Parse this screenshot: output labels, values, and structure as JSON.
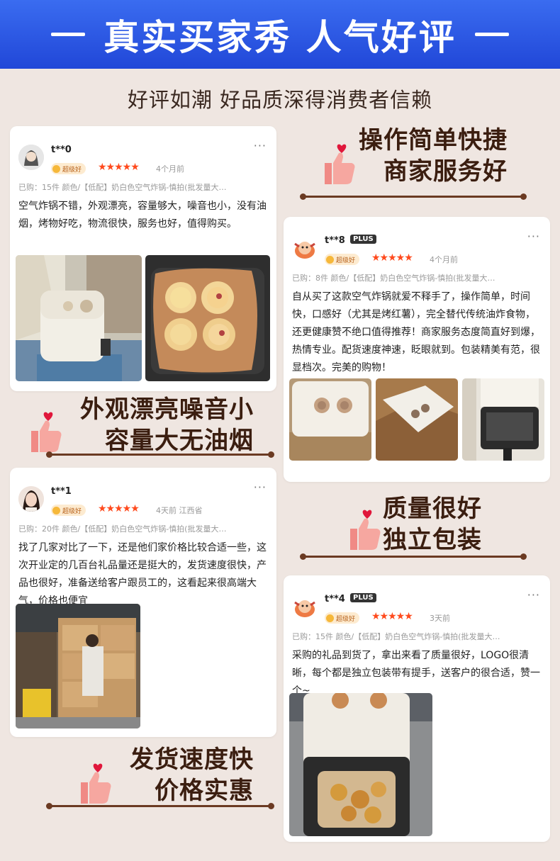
{
  "header": {
    "title": "真实买家秀  人气好评",
    "subtitle": "好评如潮 好品质深得消费者信赖"
  },
  "reviews": [
    {
      "user": "t**0",
      "plus": "",
      "badge": "超级好",
      "stars": "★★★★★",
      "ago": "4个月前",
      "meta": "已购：15件  颜色/【低配】奶白色空气炸锅-慎拍(批发量大…",
      "text": "空气炸锅不错，外观漂亮，容量够大，噪音也小，没有油烟，烤物好吃，物流很快，服务也好，值得购买。"
    },
    {
      "user": "t**8",
      "plus": "PLUS",
      "badge": "超级好",
      "stars": "★★★★★",
      "ago": "4个月前",
      "meta": "已购：8件  颜色/【低配】奶白色空气炸锅-慎拍(批发量大…",
      "text": "自从买了这款空气炸锅就爱不释手了，操作简单，时间快，口感好（尤其是烤红薯），完全替代传统油炸食物，还更健康赞不绝口值得推荐！商家服务态度简直好到爆，热情专业。配货速度神速，眨眼就到。包装精美有范，很显档次。完美的购物！"
    },
    {
      "user": "t**1",
      "plus": "",
      "badge": "超级好",
      "stars": "★★★★★",
      "ago": "4天前   江西省",
      "meta": "已购：20件  颜色/【低配】奶白色空气炸锅-慎拍(批发量大…",
      "text": "找了几家对比了一下，还是他们家价格比较合适一些，这次开业定的几百台礼品量还是挺大的，发货速度很快，产品也很好，准备送给客户跟员工的，这看起来很高端大气，价格也便宜"
    },
    {
      "user": "t**4",
      "plus": "PLUS",
      "badge": "超级好",
      "stars": "★★★★★",
      "ago": "3天前",
      "meta": "已购：15件  颜色/【低配】奶白色空气炸锅-慎拍(批发量大…",
      "text": "采购的礼品到货了，拿出来看了质量很好，LOGO很清晰，每个都是独立包装带有提手，送客户的很合适，赞一个~"
    }
  ],
  "tags": {
    "t1_line1": "操作简单快捷",
    "t1_line2": "商家服务好",
    "t2_line1": "外观漂亮噪音小",
    "t2_line2": "容量大无油烟",
    "t3_line1": "质量很好",
    "t3_line2": "独立包装",
    "t4_line1": "发货速度快",
    "t4_line2": "价格实惠"
  },
  "icons": {
    "more": "more-dots-icon",
    "thumbs": "thumbs-up-heart-icon"
  },
  "colors": {
    "banner": "#2a52e0",
    "background": "#efe6e1",
    "tag_text": "#3b1e10",
    "stars": "#ff4a1d"
  }
}
